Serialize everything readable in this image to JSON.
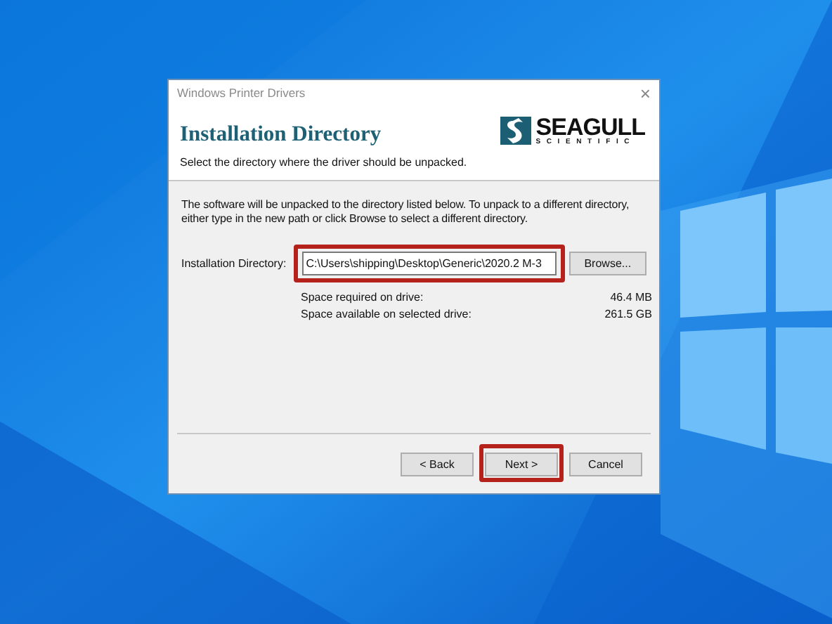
{
  "window": {
    "title": "Windows Printer Drivers",
    "close": "×"
  },
  "header": {
    "title": "Installation Directory",
    "subtitle": "Select the directory where the driver should be unpacked.",
    "logo": {
      "name": "SEAGULL",
      "tagline": "SCIENTIFIC"
    }
  },
  "intro": "The software will be unpacked to the directory listed below.  To unpack to a different directory, either type in the new path or click Browse to select a different directory.",
  "directory": {
    "label": "Installation Directory:",
    "value": "C:\\Users\\shipping\\Desktop\\Generic\\2020.2 M-3",
    "highlighted": true,
    "browse": "Browse..."
  },
  "space": [
    {
      "label": "Space required on drive:",
      "value": "46.4 MB"
    },
    {
      "label": "Space available on selected drive:",
      "value": "261.5 GB"
    }
  ],
  "buttons": [
    {
      "label": "< Back",
      "highlighted": false
    },
    {
      "label": "Next >",
      "highlighted": true
    },
    {
      "label": "Cancel",
      "highlighted": false
    }
  ]
}
